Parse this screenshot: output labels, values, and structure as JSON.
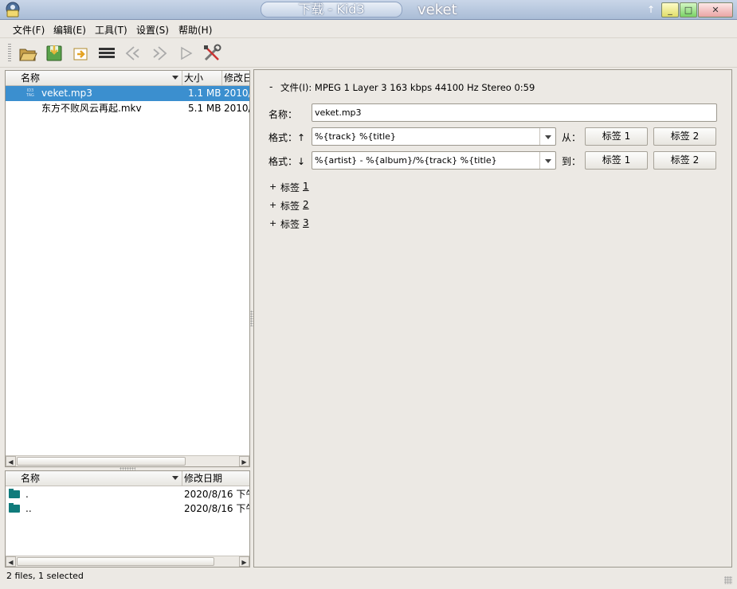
{
  "window": {
    "title": "下载 - Kid3",
    "right_title": "veket",
    "pin_glyph": "↑",
    "min_glyph": "_",
    "max_glyph": "□",
    "close_glyph": "✕"
  },
  "menu": {
    "file": "文件(F)",
    "edit": "编辑(E)",
    "tools": "工具(T)",
    "settings": "设置(S)",
    "help": "帮助(H)"
  },
  "toolbar": {
    "icons": [
      "open-folder-icon",
      "save-icon",
      "revert-icon",
      "list-icon",
      "previous-icon",
      "next-icon",
      "play-icon",
      "settings-tools-icon"
    ]
  },
  "file_list": {
    "columns": [
      "名称",
      "大小",
      "修改日"
    ],
    "rows": [
      {
        "name": "veket.mp3",
        "size": "1.1 MB",
        "date": "2010/",
        "selected": true
      },
      {
        "name": "东方不败风云再起.mkv",
        "size": "5.1 MB",
        "date": "2010/",
        "selected": false
      }
    ]
  },
  "dir_list": {
    "columns": [
      "名称",
      "修改日期"
    ],
    "rows": [
      {
        "name": ".",
        "date": "2020/8/16 下午"
      },
      {
        "name": "..",
        "date": "2020/8/16 下午"
      }
    ]
  },
  "detail": {
    "collapse_sign": "-",
    "file_info": "文件(I): MPEG 1 Layer 3 163 kbps 44100 Hz Stereo 0:59",
    "name_label": "名称：",
    "name_value": "veket.mp3",
    "format_from_label": "格式：↑",
    "format_from_value": "%{track} %{title}",
    "from_label": "从：",
    "format_to_label": "格式：↓",
    "format_to_value": "%{artist} - %{album}/%{track} %{title}",
    "to_label": "到：",
    "tag1_button": "标签 1",
    "tag2_button": "标签 2",
    "tag_sections": [
      {
        "sign": "+",
        "text": "标签 ",
        "num": "1"
      },
      {
        "sign": "+",
        "text": "标签 ",
        "num": "2"
      },
      {
        "sign": "+",
        "text": "标签 ",
        "num": "3"
      }
    ]
  },
  "status": "2 files, 1 selected",
  "colors": {
    "selection": "#3b8fcf",
    "folder": "#107b7b"
  }
}
